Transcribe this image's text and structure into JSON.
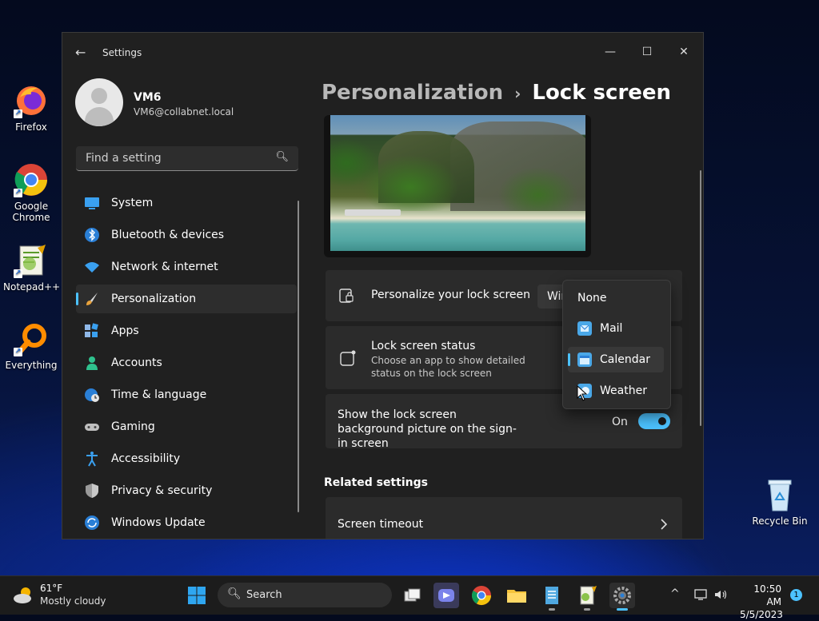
{
  "desktop": {
    "icons": [
      {
        "label": "Firefox",
        "icon": "firefox-icon"
      },
      {
        "label": "Google Chrome",
        "icon": "chrome-icon"
      },
      {
        "label": "Notepad++",
        "icon": "notepadpp-icon"
      },
      {
        "label": "Everything",
        "icon": "everything-search-icon"
      },
      {
        "label": "Recycle Bin",
        "icon": "recycle-bin-icon"
      }
    ]
  },
  "window": {
    "title": "Settings",
    "back_icon": "back-arrow-icon",
    "controls": {
      "minimize": "—",
      "maximize": "☐",
      "close": "✕"
    }
  },
  "profile": {
    "name": "VM6",
    "email": "VM6@collabnet.local"
  },
  "search": {
    "placeholder": "Find a setting",
    "icon": "search-icon"
  },
  "nav": {
    "items": [
      {
        "label": "System",
        "icon": "system-monitor-icon",
        "active": false
      },
      {
        "label": "Bluetooth & devices",
        "icon": "bluetooth-icon",
        "active": false
      },
      {
        "label": "Network & internet",
        "icon": "wifi-icon",
        "active": false
      },
      {
        "label": "Personalization",
        "icon": "paintbrush-icon",
        "active": true
      },
      {
        "label": "Apps",
        "icon": "apps-grid-icon",
        "active": false
      },
      {
        "label": "Accounts",
        "icon": "person-icon",
        "active": false
      },
      {
        "label": "Time & language",
        "icon": "globe-clock-icon",
        "active": false
      },
      {
        "label": "Gaming",
        "icon": "gamepad-icon",
        "active": false
      },
      {
        "label": "Accessibility",
        "icon": "accessibility-icon",
        "active": false
      },
      {
        "label": "Privacy & security",
        "icon": "shield-icon",
        "active": false
      },
      {
        "label": "Windows Update",
        "icon": "update-icon",
        "active": false
      }
    ]
  },
  "breadcrumb": {
    "parent": "Personalization",
    "separator": "›",
    "current": "Lock screen"
  },
  "main": {
    "personalize": {
      "title": "Personalize your lock screen",
      "combo_value": "Wir",
      "icon": "lock-screen-icon"
    },
    "status": {
      "title": "Lock screen status",
      "subtitle": "Choose an app to show detailed status on the lock screen",
      "icon": "lock-status-icon"
    },
    "background": {
      "title": "Show the lock screen background picture on the sign-in screen",
      "toggle_label": "On",
      "toggle_on": true
    },
    "related_heading": "Related settings",
    "screen_timeout": {
      "title": "Screen timeout",
      "icon": "chevron-right-icon"
    }
  },
  "dropdown": {
    "options": [
      {
        "label": "None",
        "icon": "",
        "selected": false
      },
      {
        "label": "Mail",
        "icon": "mail-icon",
        "selected": false
      },
      {
        "label": "Calendar",
        "icon": "calendar-icon",
        "selected": true
      },
      {
        "label": "Weather",
        "icon": "weather-icon",
        "selected": false
      }
    ]
  },
  "taskbar": {
    "weather": {
      "temp": "61°F",
      "desc": "Mostly cloudy",
      "icon": "partly-cloudy-icon"
    },
    "search_label": "Search",
    "apps": [
      {
        "name": "start",
        "icon": "windows-start-icon"
      },
      {
        "name": "task-view",
        "icon": "task-view-icon"
      },
      {
        "name": "teams-chat",
        "icon": "teams-chat-icon"
      },
      {
        "name": "chrome",
        "icon": "chrome-icon"
      },
      {
        "name": "file-explorer",
        "icon": "folder-icon"
      },
      {
        "name": "notepad",
        "icon": "notepad-icon"
      },
      {
        "name": "notepadpp",
        "icon": "notepadpp-icon"
      },
      {
        "name": "settings",
        "icon": "gear-icon"
      }
    ],
    "clock": {
      "time": "10:50 AM",
      "date": "5/5/2023"
    },
    "notification_count": "1",
    "colors": {
      "accent": "#4cc2ff"
    }
  }
}
